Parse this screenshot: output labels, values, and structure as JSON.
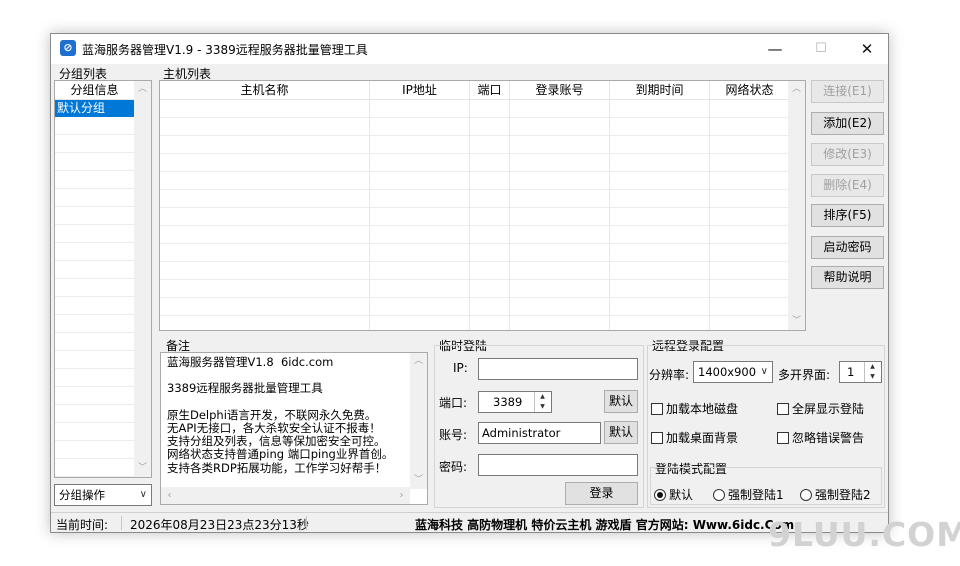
{
  "window": {
    "title": "蓝海服务器管理V1.9 - 3389远程服务器批量管理工具",
    "minimize": "—",
    "maximize": "☐",
    "close": "✕"
  },
  "groups": {
    "section_label": "分组列表",
    "header": "分组信息",
    "items": [
      "默认分组"
    ],
    "selected": "默认分组",
    "operation_select": "分组操作"
  },
  "hosts": {
    "section_label": "主机列表",
    "columns": [
      "主机名称",
      "IP地址",
      "端口",
      "登录账号",
      "到期时间",
      "网络状态"
    ],
    "rows": []
  },
  "actions": {
    "connect": "连接(E1)",
    "add": "添加(E2)",
    "edit": "修改(E3)",
    "delete": "删除(E4)",
    "sort": "排序(F5)",
    "password": "启动密码",
    "help": "帮助说明"
  },
  "notes": {
    "label": "备注",
    "text": "蓝海服务器管理V1.8  6idc.com\n\n3389远程服务器批量管理工具\n\n原生Delphi语言开发，不联网永久免费。\n无API无接口，各大杀软安全认证不报毒！\n支持分组及列表，信息等保加密安全可控。\n网络状态支持普通ping 端口ping业界首创。\n支持各类RDP拓展功能，工作学习好帮手！"
  },
  "temp_login": {
    "label": "临时登陆",
    "ip_label": "IP:",
    "ip_value": "",
    "port_label": "端口:",
    "port_value": "3389",
    "port_default": "默认",
    "account_label": "账号:",
    "account_value": "Administrator",
    "account_default": "默认",
    "password_label": "密码:",
    "password_value": "",
    "login_button": "登录"
  },
  "remote_config": {
    "label": "远程登录配置",
    "resolution_label": "分辨率:",
    "resolution_value": "1400x900",
    "multi_label": "多开界面:",
    "multi_value": "1",
    "load_disk": "加载本地磁盘",
    "fullscreen": "全屏显示登陆",
    "load_wallpaper": "加载桌面背景",
    "ignore_errors": "忽略错误警告",
    "mode_label": "登陆模式配置",
    "modes": [
      "默认",
      "强制登陆1",
      "强制登陆2"
    ],
    "mode_selected": "默认"
  },
  "status": {
    "time_label": "当前时间:",
    "time_value": "2026年08月23日23点23分13秒",
    "company": "蓝海科技 高防物理机 特价云主机 游戏盾 官方网站: Www.6idc.Com"
  },
  "watermark": "9LUU.COM"
}
